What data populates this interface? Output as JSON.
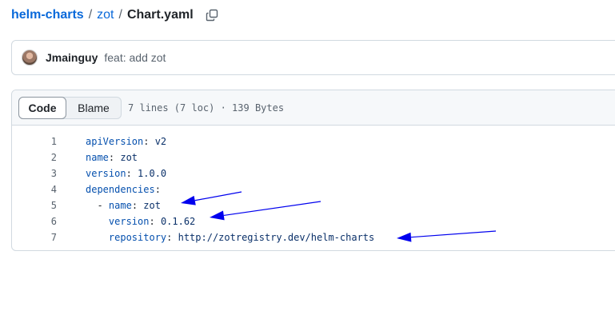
{
  "breadcrumb": {
    "repo": "helm-charts",
    "separator": "/",
    "dir": "zot",
    "file": "Chart.yaml",
    "copy_icon": "copy-icon"
  },
  "commit": {
    "author": "Jmainguy",
    "message": "feat: add zot"
  },
  "file": {
    "tabs": [
      {
        "label": "Code",
        "active": true
      },
      {
        "label": "Blame",
        "active": false
      }
    ],
    "meta": "7 lines (7 loc) · 139 Bytes",
    "lines": [
      {
        "n": "1",
        "indent": "",
        "key": "apiVersion",
        "sep": ": ",
        "value": "v2"
      },
      {
        "n": "2",
        "indent": "",
        "key": "name",
        "sep": ": ",
        "value": "zot"
      },
      {
        "n": "3",
        "indent": "",
        "key": "version",
        "sep": ": ",
        "value": "1.0.0"
      },
      {
        "n": "4",
        "indent": "",
        "key": "dependencies",
        "sep": ":",
        "value": ""
      },
      {
        "n": "5",
        "indent": "  - ",
        "key": "name",
        "sep": ": ",
        "value": "zot"
      },
      {
        "n": "6",
        "indent": "    ",
        "key": "version",
        "sep": ": ",
        "value": "0.1.62"
      },
      {
        "n": "7",
        "indent": "    ",
        "key": "repository",
        "sep": ": ",
        "value": "http://zotregistry.dev/helm-charts"
      }
    ]
  },
  "colors": {
    "link": "#0969da",
    "yaml_key": "#0550ae",
    "yaml_value": "#0a3069",
    "annotation_arrow": "#0000ee"
  }
}
